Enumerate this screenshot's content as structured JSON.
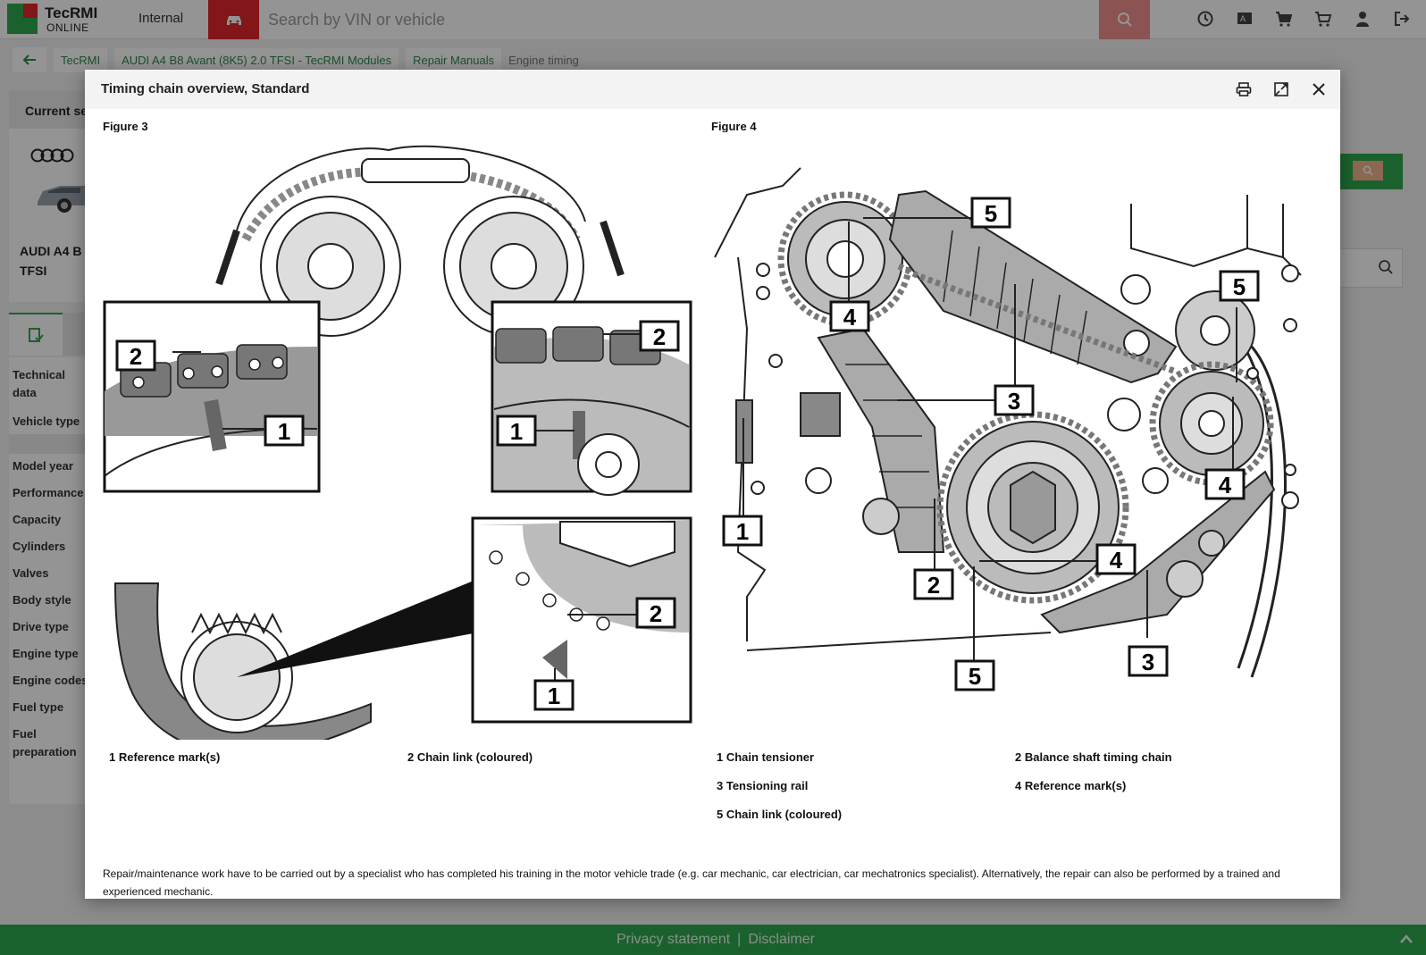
{
  "app": {
    "logo_title": "TecRMI",
    "logo_subtitle": "ONLINE",
    "environment": "Internal",
    "search_placeholder": "Search by VIN or vehicle",
    "brand_color": "#2fa84f",
    "accent_color": "#e0262a",
    "top_icons": [
      "history-icon",
      "translate-icon",
      "cart-icon",
      "cart-remove-icon",
      "user-icon",
      "logout-icon"
    ]
  },
  "breadcrumb": {
    "items": [
      "TecRMI",
      "AUDI A4 B8 Avant (8K5) 2.0 TFSI - TecRMI Modules",
      "Repair Manuals"
    ],
    "current": "Engine timing"
  },
  "sidebar": {
    "header": "Current se",
    "vehicle_name_line1": "AUDI A4 B",
    "vehicle_name_line2": "TFSI",
    "items": [
      "Technical data",
      "Vehicle type",
      "Model year",
      "Performance",
      "Capacity",
      "Cylinders",
      "Valves",
      "Body style",
      "Drive type",
      "Engine type",
      "Engine codes",
      "Fuel type",
      "Fuel preparation"
    ]
  },
  "modal": {
    "title": "Timing chain overview, Standard",
    "figure3": {
      "label": "Figure 3",
      "legend": [
        "1 Reference mark(s)",
        "2 Chain link (coloured)"
      ]
    },
    "figure4": {
      "label": "Figure 4",
      "legend": [
        "1 Chain tensioner",
        "2 Balance shaft timing chain",
        "3 Tensioning rail",
        "4 Reference mark(s)",
        "5 Chain link (coloured)"
      ]
    },
    "callouts": {
      "one": "1",
      "two": "2",
      "three": "3",
      "four": "4",
      "five": "5"
    },
    "note": "Repair/maintenance work have to be carried out by a specialist who has completed his training in the motor vehicle trade (e.g. car mechanic, car electrician, car mechatronics specialist). Alternatively, the repair can also be performed by a trained and experienced mechanic."
  },
  "footer": {
    "privacy": "Privacy statement",
    "separator": "|",
    "disclaimer": "Disclaimer"
  }
}
